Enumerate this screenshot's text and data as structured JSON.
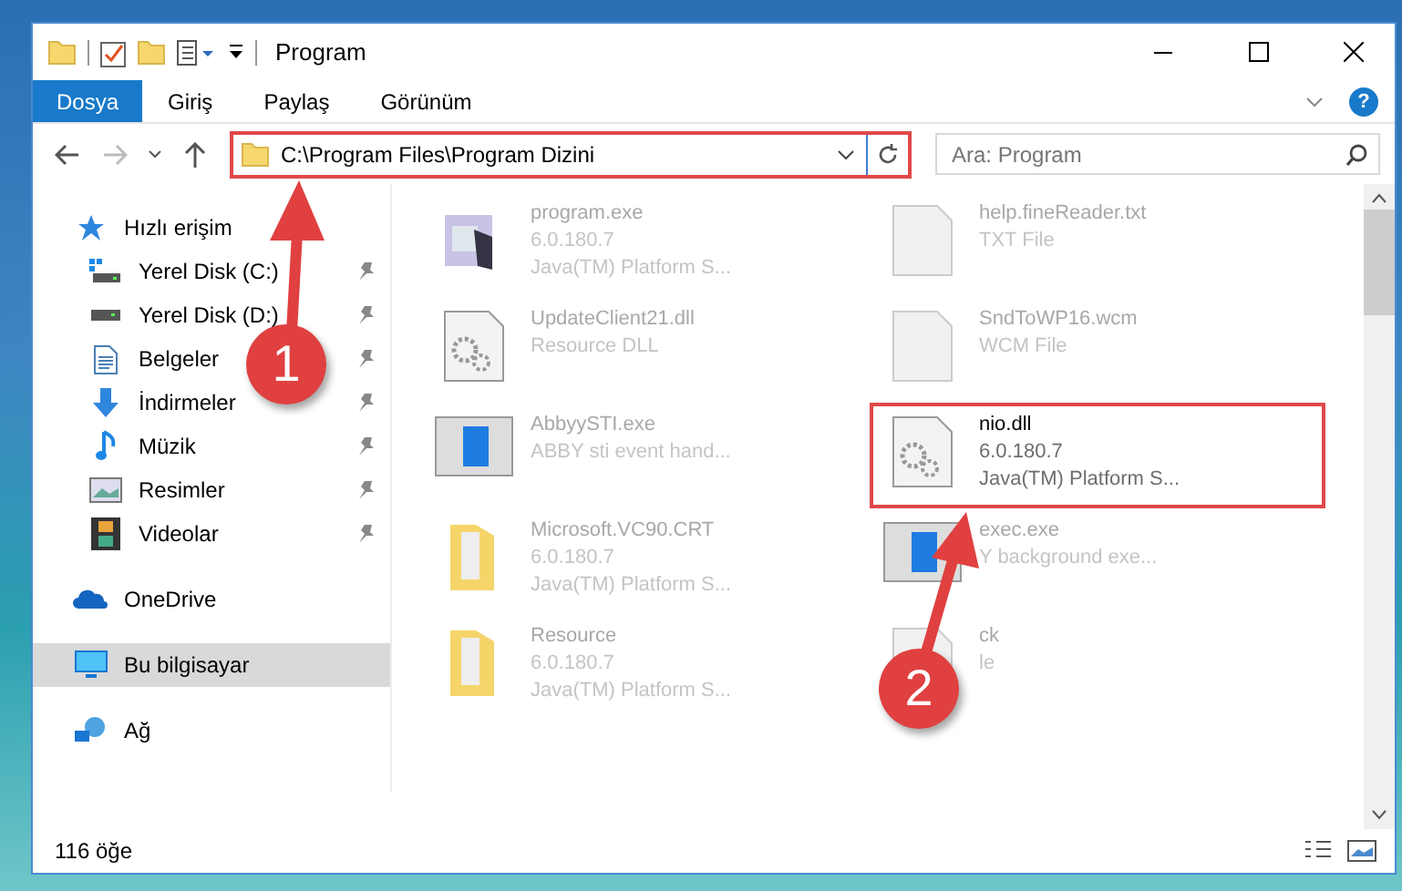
{
  "window": {
    "title": "Program"
  },
  "ribbon": {
    "tabs": [
      {
        "label": "Dosya",
        "kind": "file"
      },
      {
        "label": "Giriş",
        "kind": "tab"
      },
      {
        "label": "Paylaş",
        "kind": "tab"
      },
      {
        "label": "Görünüm",
        "kind": "tab"
      }
    ],
    "help": "?"
  },
  "address_bar": {
    "path": "C:\\Program Files\\Program Dizini",
    "highlighted": true
  },
  "search": {
    "placeholder": "Ara: Program"
  },
  "navigation": [
    {
      "label": "Hızlı erişim",
      "kind": "star",
      "selected": false,
      "children": [
        {
          "label": "Yerel Disk (C:)",
          "kind": "system-drive",
          "pinned": true,
          "selected": false
        },
        {
          "label": "Yerel Disk (D:)",
          "kind": "drive",
          "pinned": true,
          "selected": false
        },
        {
          "label": "Belgeler",
          "kind": "documents",
          "pinned": true,
          "selected": false
        },
        {
          "label": "İndirmeler",
          "kind": "downloads",
          "pinned": true,
          "selected": false
        },
        {
          "label": "Müzik",
          "kind": "music",
          "pinned": true,
          "selected": false
        },
        {
          "label": "Resimler",
          "kind": "pictures",
          "pinned": true,
          "selected": false
        },
        {
          "label": "Videolar",
          "kind": "videos",
          "pinned": true,
          "selected": false
        }
      ]
    },
    {
      "label": "OneDrive",
      "kind": "cloud",
      "selected": false
    },
    {
      "label": "Bu bilgisayar",
      "kind": "computer",
      "selected": true
    },
    {
      "label": "Ağ",
      "kind": "network",
      "selected": false
    }
  ],
  "files": [
    {
      "name": "program.exe",
      "details": [
        "6.0.180.7",
        "Java(TM) Platform S..."
      ],
      "kind": "app",
      "blurred": true,
      "highlighted": false
    },
    {
      "name": "UpdateClient21.dll",
      "details": [
        "Resource DLL"
      ],
      "kind": "dll",
      "blurred": true,
      "highlighted": false
    },
    {
      "name": "AbbyySTI.exe",
      "details": [
        "ABBY sti event hand..."
      ],
      "kind": "window",
      "blurred": true,
      "highlighted": false
    },
    {
      "name": "Microsoft.VC90.CRT",
      "details": [
        "6.0.180.7",
        "Java(TM) Platform S..."
      ],
      "kind": "folder",
      "blurred": true,
      "highlighted": false
    },
    {
      "name": "Resource",
      "details": [
        "6.0.180.7",
        "Java(TM) Platform S..."
      ],
      "kind": "folder",
      "blurred": true,
      "highlighted": false
    },
    {
      "name": "help.fineReader.txt",
      "details": [
        "TXT File"
      ],
      "kind": "text",
      "blurred": true,
      "highlighted": false
    },
    {
      "name": "SndToWP16.wcm",
      "details": [
        "WCM File"
      ],
      "kind": "text",
      "blurred": true,
      "highlighted": false
    },
    {
      "name": "nio.dll",
      "details": [
        "6.0.180.7",
        "Java(TM) Platform S..."
      ],
      "kind": "dll",
      "blurred": false,
      "highlighted": true
    },
    {
      "name": "exec.exe",
      "details": [
        "Y background exe..."
      ],
      "kind": "window",
      "blurred": true,
      "highlighted": false
    },
    {
      "name": "ck",
      "details": [
        "le"
      ],
      "kind": "text",
      "blurred": true,
      "highlighted": false
    }
  ],
  "annotations": [
    {
      "label": "1"
    },
    {
      "label": "2"
    }
  ],
  "status_bar": {
    "count": "116 öğe"
  }
}
